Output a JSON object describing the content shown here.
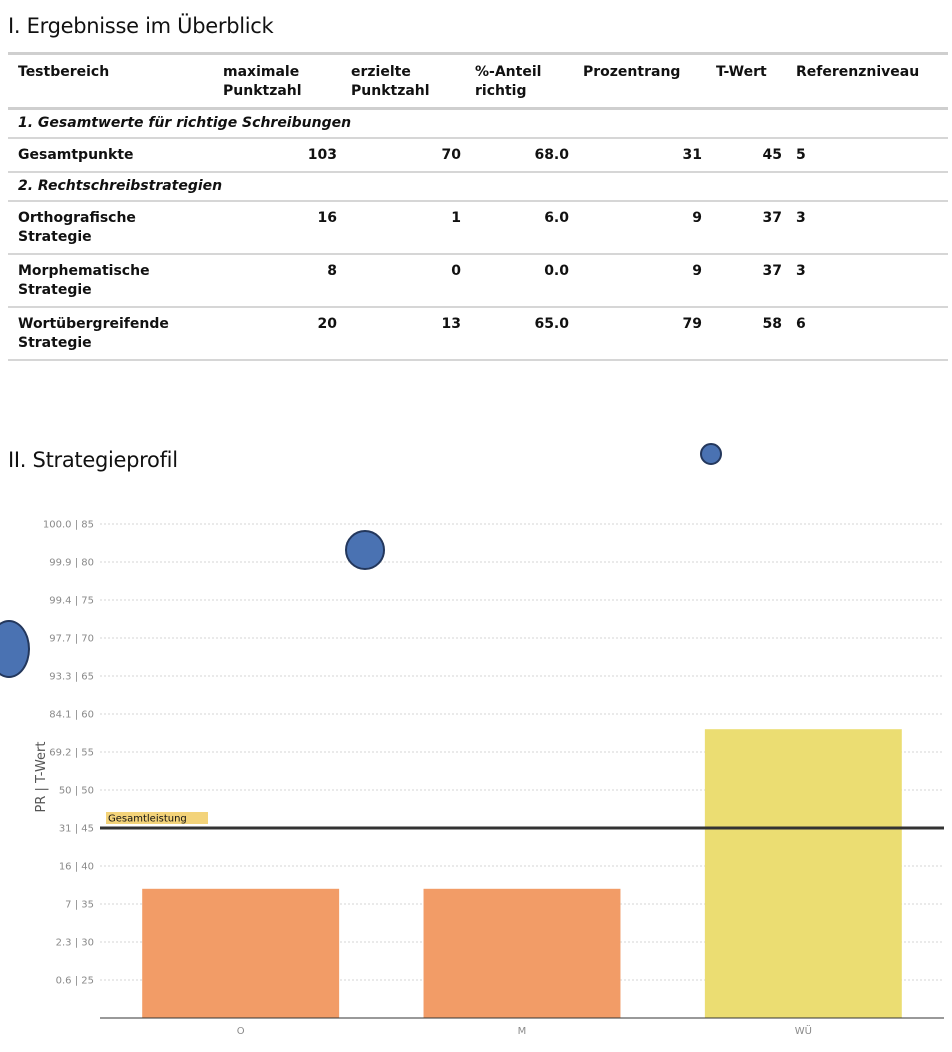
{
  "section1": {
    "title": "I. Ergebnisse im Überblick"
  },
  "table": {
    "headers": {
      "testbereich": "Testbereich",
      "max_l1": "maximale",
      "max_l2": "Punktzahl",
      "erz_l1": "erzielte",
      "erz_l2": "Punktzahl",
      "pct_l1": "%-Anteil",
      "pct_l2": "richtig",
      "prozentrang": "Prozentrang",
      "twert": "T-Wert",
      "referenzniveau": "Referenzniveau"
    },
    "sections": [
      {
        "title": "1. Gesamtwerte für richtige Schreibungen",
        "rows": [
          {
            "l1": "Gesamtpunkte",
            "l2": "",
            "max": "103",
            "erz": "70",
            "pct": "68.0",
            "pr": "31",
            "t": "45",
            "ref": "5"
          }
        ]
      },
      {
        "title": "2. Rechtschreibstrategien",
        "rows": [
          {
            "l1": "Orthografische",
            "l2": "Strategie",
            "max": "16",
            "erz": "1",
            "pct": "6.0",
            "pr": "9",
            "t": "37",
            "ref": "3"
          },
          {
            "l1": "Morphematische",
            "l2": "Strategie",
            "max": "8",
            "erz": "0",
            "pct": "0.0",
            "pr": "9",
            "t": "37",
            "ref": "3"
          },
          {
            "l1": "Wortübergreifende",
            "l2": "Strategie",
            "max": "20",
            "erz": "13",
            "pct": "65.0",
            "pr": "79",
            "t": "58",
            "ref": "6"
          }
        ]
      }
    ]
  },
  "section2": {
    "title": "II. Strategieprofil"
  },
  "chart_data": {
    "type": "bar",
    "categories": [
      "O",
      "M",
      "WÜ"
    ],
    "values": [
      37,
      37,
      58
    ],
    "ylabel": "PR | T-Wert",
    "ylim": [
      20,
      85
    ],
    "yticks": [
      {
        "v": 25,
        "label": "0.6 | 25"
      },
      {
        "v": 30,
        "label": "2.3 | 30"
      },
      {
        "v": 35,
        "label": "7 | 35"
      },
      {
        "v": 40,
        "label": "16 | 40"
      },
      {
        "v": 45,
        "label": "31 | 45"
      },
      {
        "v": 50,
        "label": "50 | 50"
      },
      {
        "v": 55,
        "label": "69.2 | 55"
      },
      {
        "v": 60,
        "label": "84.1 | 60"
      },
      {
        "v": 65,
        "label": "93.3 | 65"
      },
      {
        "v": 70,
        "label": "97.7 | 70"
      },
      {
        "v": 75,
        "label": "99.4 | 75"
      },
      {
        "v": 80,
        "label": "99.9 | 80"
      },
      {
        "v": 85,
        "label": "100.0 | 85"
      }
    ],
    "bar_colors": [
      "#f29c67",
      "#f29c67",
      "#ebdd72"
    ],
    "reference_line": {
      "value": 45,
      "label": "Gesamtleistung",
      "label_bg": "#f3d37a",
      "color": "#333333"
    },
    "grid": true
  }
}
